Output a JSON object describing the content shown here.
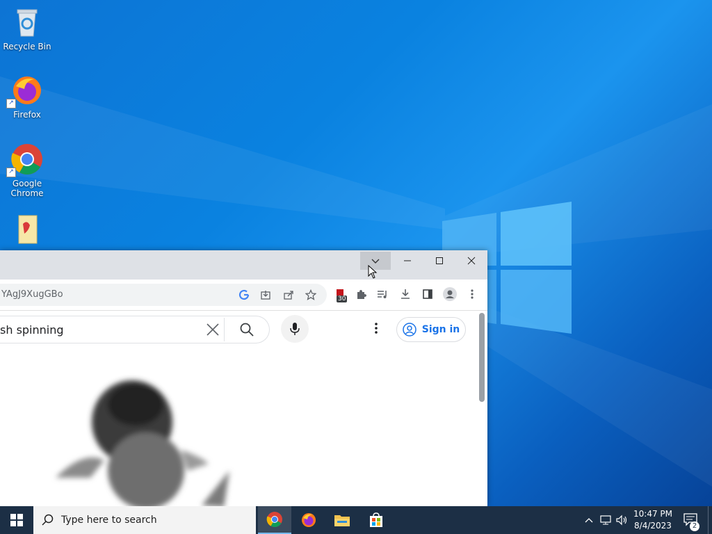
{
  "desktop": {
    "icons": [
      {
        "label": "Recycle Bin"
      },
      {
        "label": "Firefox"
      },
      {
        "label": "Google Chrome"
      },
      {
        "label": ""
      }
    ]
  },
  "browser": {
    "url_partial": "YAgJ9XugGBo",
    "search_query": "sh spinning",
    "sign_in_label": "Sign in",
    "extension_badge": "30"
  },
  "taskbar": {
    "search_placeholder": "Type here to search",
    "time": "10:47 PM",
    "date": "8/4/2023",
    "notification_count": "2"
  },
  "colors": {
    "desktop_bg": "#0a78d7",
    "taskbar_bg": "#1c2f45",
    "chrome_title_bg": "#dee1e6",
    "accent_blue": "#1a73e8"
  }
}
